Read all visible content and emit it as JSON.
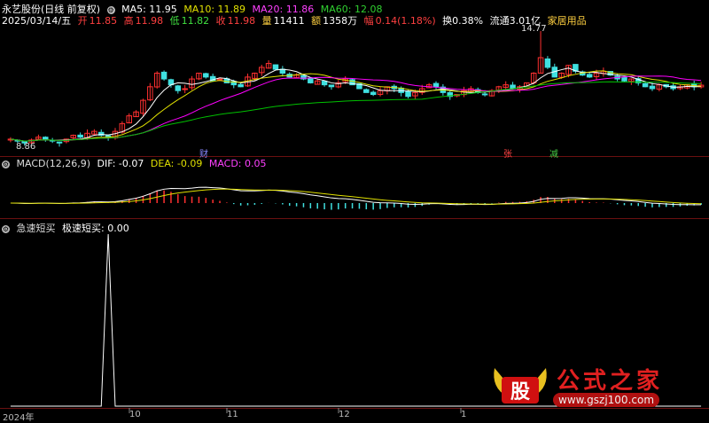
{
  "header": {
    "title": "永艺股份(日线 前复权)",
    "ma5": "MA5: 11.95",
    "ma10": "MA10: 11.89",
    "ma20": "MA20: 11.86",
    "ma60": "MA60: 12.08"
  },
  "info": {
    "date": "2025/03/14/五",
    "open_label": "开",
    "open": "11.85",
    "high_label": "高",
    "high": "11.98",
    "low_label": "低",
    "low": "11.82",
    "close_label": "收",
    "close": "11.98",
    "vol_label": "量",
    "vol": "11411",
    "amt_label": "额",
    "amt": "1358万",
    "chg_label": "幅",
    "chg": "0.14(1.18%)",
    "turnover": "换0.38%",
    "float": "流通3.01亿",
    "industry": "家居用品"
  },
  "price_annotations": {
    "high": "14.77",
    "low": "8.86"
  },
  "event_markers": [
    {
      "label": "财",
      "color": "#8888ff"
    },
    {
      "label": "张",
      "color": "#ff4444"
    },
    {
      "label": "减",
      "color": "#44cc44"
    }
  ],
  "macd": {
    "name": "MACD(12,26,9)",
    "dif": "DIF: -0.07",
    "dea": "DEA: -0.09",
    "macd": "MACD: 0.05"
  },
  "ind3": {
    "name": "急速短买",
    "label": "极速短买: 0.00"
  },
  "x_axis": {
    "labels": [
      "2024年",
      "10",
      "11",
      "12",
      "1"
    ]
  },
  "watermark": {
    "title": "公式之家",
    "url": "www.gszj100.com",
    "logo_text": "股"
  },
  "colors": {
    "up": "#ff3030",
    "down": "#40e0e0",
    "ma5": "#ffffff",
    "ma10": "#e0e000",
    "ma20": "#ff00ff",
    "ma60": "#00c000",
    "bg": "#000000",
    "grid": "#6b1010"
  },
  "chart_data": [
    {
      "type": "candlestick",
      "title": "永艺股份(日线 前复权)",
      "close": [
        9.2,
        9.1,
        9.0,
        9.15,
        9.3,
        9.2,
        9.1,
        9.0,
        9.2,
        9.4,
        9.3,
        9.5,
        9.6,
        9.4,
        9.3,
        9.6,
        10.0,
        10.4,
        10.6,
        11.2,
        11.9,
        12.6,
        12.3,
        12.0,
        11.7,
        11.8,
        12.3,
        12.6,
        12.4,
        12.2,
        12.3,
        12.1,
        12.0,
        11.9,
        12.4,
        12.6,
        12.9,
        13.1,
        12.8,
        12.6,
        12.4,
        12.5,
        12.3,
        12.1,
        12.2,
        12.0,
        11.9,
        12.1,
        12.3,
        12.0,
        11.8,
        11.6,
        11.5,
        11.7,
        11.9,
        11.8,
        11.6,
        11.4,
        11.6,
        11.8,
        12.0,
        11.9,
        11.6,
        11.4,
        11.5,
        11.7,
        11.8,
        11.6,
        11.5,
        11.7,
        11.9,
        12.0,
        11.8,
        11.9,
        12.1,
        12.6,
        13.4,
        12.9,
        12.4,
        12.6,
        13.0,
        12.7,
        12.5,
        12.4,
        12.6,
        12.7,
        12.5,
        12.3,
        12.2,
        12.3,
        12.1,
        11.9,
        11.8,
        12.0,
        11.9,
        11.8,
        11.9,
        12.0,
        11.9,
        11.98
      ],
      "ma_periods": [
        5,
        10,
        20,
        60
      ],
      "annotations": {
        "high": 14.77,
        "low": 8.86
      }
    },
    {
      "type": "macd",
      "dif_last": -0.07,
      "dea_last": -0.09,
      "macd_last": 0.05
    },
    {
      "type": "line",
      "name": "极速短买",
      "last_value": 0.0,
      "spike_value": 1.0
    }
  ]
}
